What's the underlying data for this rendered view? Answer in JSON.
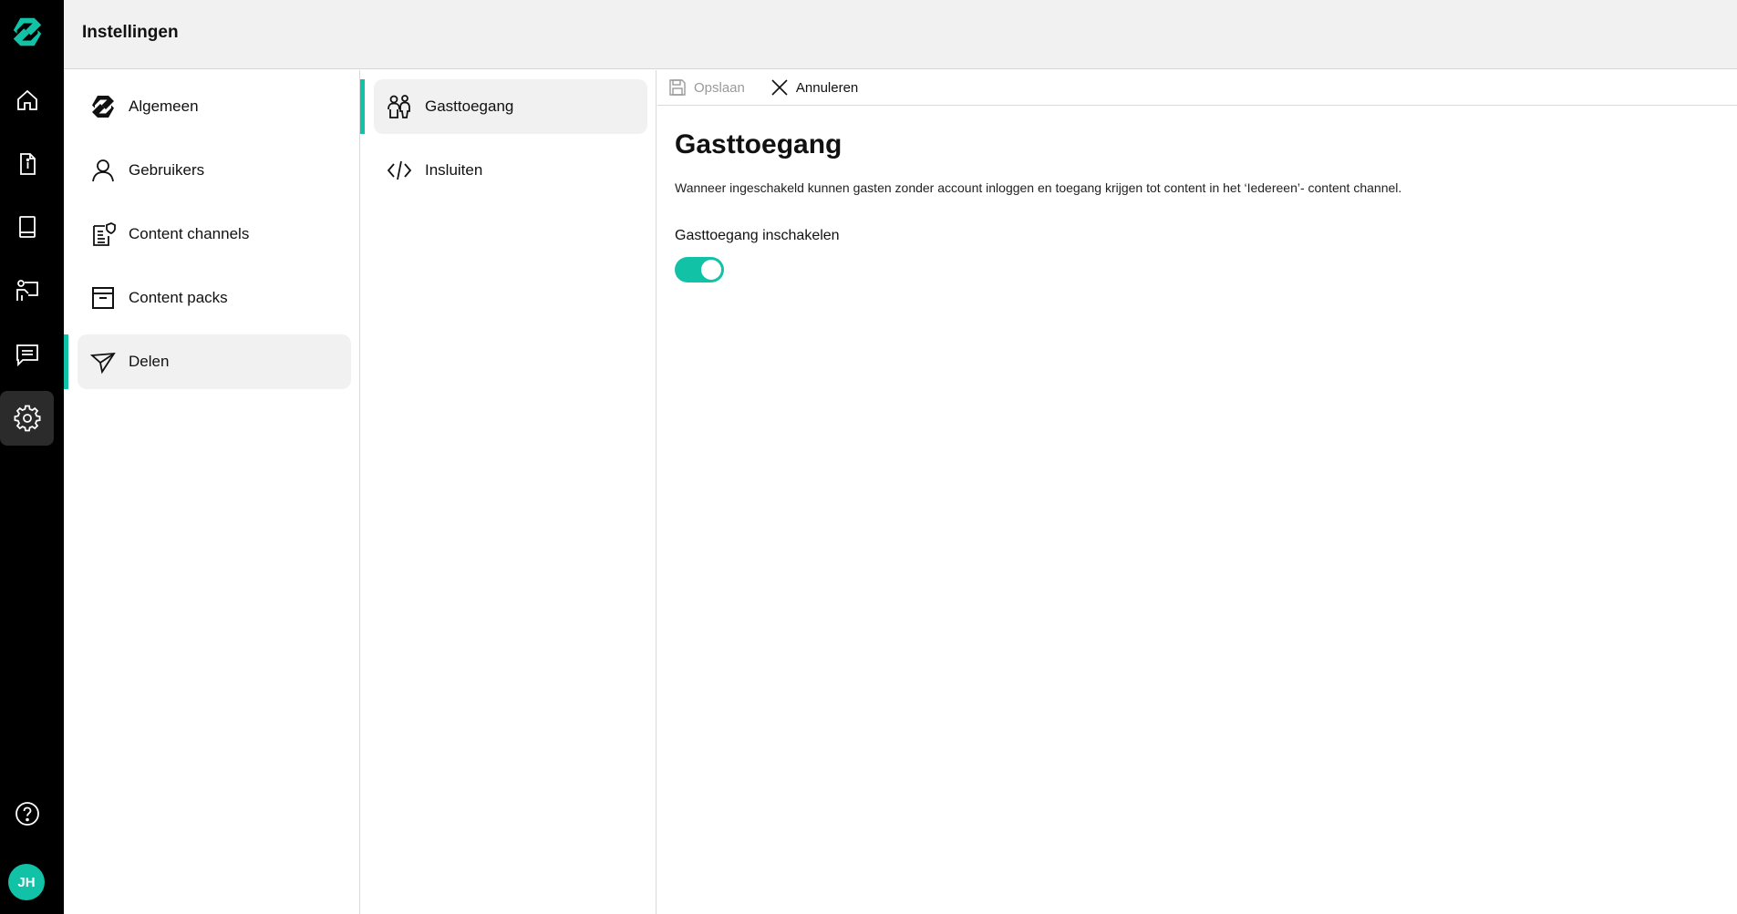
{
  "header": {
    "title": "Instellingen"
  },
  "rail": {
    "items": [
      {
        "name": "home-icon"
      },
      {
        "name": "document-info-icon"
      },
      {
        "name": "book-icon"
      },
      {
        "name": "presentation-icon"
      },
      {
        "name": "chat-icon"
      },
      {
        "name": "gear-icon",
        "active": true
      }
    ],
    "help_icon": "help-icon",
    "avatar_initials": "JH"
  },
  "settings_nav": {
    "items": [
      {
        "label": "Algemeen",
        "icon": "brand-logo-icon"
      },
      {
        "label": "Gebruikers",
        "icon": "user-icon"
      },
      {
        "label": "Content channels",
        "icon": "content-channels-icon"
      },
      {
        "label": "Content packs",
        "icon": "archive-box-icon"
      },
      {
        "label": "Delen",
        "icon": "send-icon",
        "active": true
      }
    ]
  },
  "sub_nav": {
    "items": [
      {
        "label": "Gasttoegang",
        "icon": "guests-icon",
        "active": true
      },
      {
        "label": "Insluiten",
        "icon": "code-icon"
      }
    ]
  },
  "toolbar": {
    "save_label": "Opslaan",
    "cancel_label": "Annuleren"
  },
  "main": {
    "title": "Gasttoegang",
    "description": "Wanneer ingeschakeld kunnen gasten zonder account inloggen en toegang krijgen tot content in het ‘Iedereen’- content channel.",
    "setting_label": "Gasttoegang inschakelen",
    "toggle_on": true
  },
  "colors": {
    "accent": "#12c2a6",
    "rail_bg": "#000000",
    "header_bg": "#f1f1f1"
  }
}
